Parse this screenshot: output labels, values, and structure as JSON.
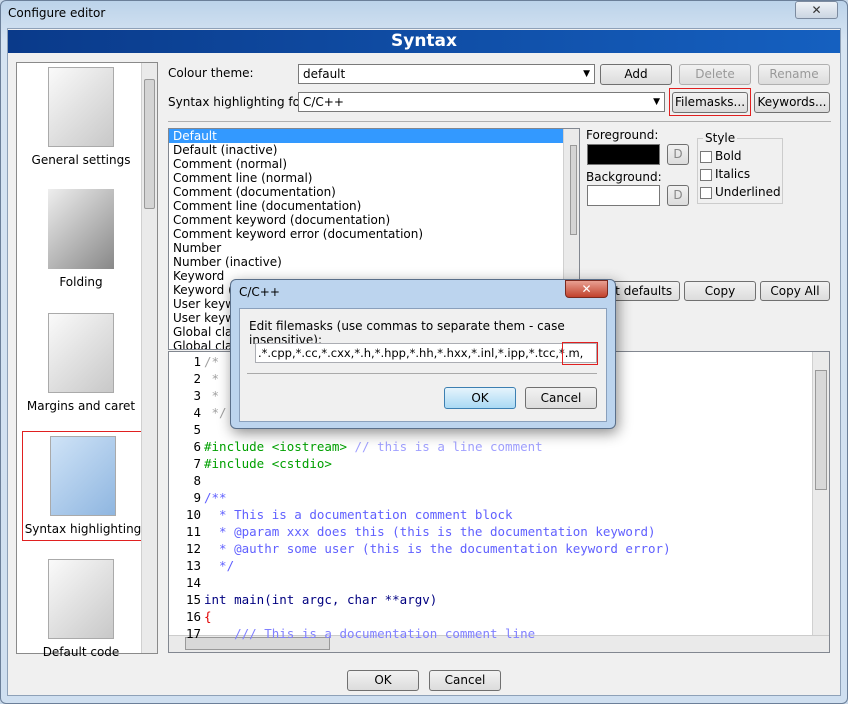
{
  "window": {
    "title": "Configure editor",
    "close_icon": "close-icon",
    "header": "Syntax"
  },
  "categories": [
    {
      "label": "General settings",
      "icon": "general-settings-icon"
    },
    {
      "label": "Folding",
      "icon": "folding-icon"
    },
    {
      "label": "Margins and caret",
      "icon": "margins-icon"
    },
    {
      "label": "Syntax highlighting",
      "icon": "syntax-highlighting-icon",
      "selected": true
    },
    {
      "label": "Default code",
      "icon": "default-code-icon"
    }
  ],
  "colour_theme": {
    "label": "Colour theme:",
    "value": "default",
    "add": "Add",
    "delete": "Delete",
    "rename": "Rename"
  },
  "syntax_for": {
    "label": "Syntax highlighting for:",
    "value": "C/C++",
    "filemasks": "Filemasks...",
    "keywords": "Keywords..."
  },
  "styles": [
    "Default",
    "Default (inactive)",
    "Comment (normal)",
    "Comment line (normal)",
    "Comment (documentation)",
    "Comment line (documentation)",
    "Comment keyword (documentation)",
    "Comment keyword error (documentation)",
    "Number",
    "Number (inactive)",
    "Keyword",
    "Keyword (",
    "User keyw",
    "User keyw",
    "Global class",
    "Global class"
  ],
  "colors": {
    "foreground_label": "Foreground:",
    "background_label": "Background:",
    "default_btn": "D",
    "foreground": "#000000",
    "background": "#ffffff"
  },
  "style": {
    "label": "Style",
    "bold": "Bold",
    "italics": "Italics",
    "underlined": "Underlined"
  },
  "style_buttons": {
    "set_defaults": "et defaults",
    "copy": "Copy",
    "copy_all": "Copy All"
  },
  "code_lines": [
    {
      "n": "1",
      "t": "/*"
    },
    {
      "n": "2",
      "t": " *"
    },
    {
      "n": "3",
      "t": " *"
    },
    {
      "n": "4",
      "t": " */"
    },
    {
      "n": "5",
      "t": ""
    },
    {
      "n": "6",
      "t": "#include <iostream>",
      "c": "// this is a line comment"
    },
    {
      "n": "7",
      "t": "#include <cstdio>"
    },
    {
      "n": "8",
      "t": ""
    },
    {
      "n": "9",
      "t": "/**"
    },
    {
      "n": "10",
      "t": "  * This is a documentation comment block"
    },
    {
      "n": "11",
      "t": "  * @param xxx does this (this is the documentation keyword)"
    },
    {
      "n": "12",
      "t": "  * @authr some user (this is the documentation keyword error)"
    },
    {
      "n": "13",
      "t": "  */"
    },
    {
      "n": "14",
      "t": ""
    },
    {
      "n": "15",
      "t": "int main(int argc, char **argv)"
    },
    {
      "n": "16",
      "t": "{"
    },
    {
      "n": "17",
      "t": "    /// This is a documentation comment line"
    }
  ],
  "dialog": {
    "title": "C/C++",
    "label": "Edit filemasks (use commas to separate them - case insensitive):",
    "value": ".*.cpp,*.cc,*.cxx,*.h,*.hpp,*.hh,*.hxx,*.inl,*.ipp,*.tcc,*.m,",
    "ok": "OK",
    "cancel": "Cancel"
  },
  "footer": {
    "ok": "OK",
    "cancel": "Cancel"
  }
}
